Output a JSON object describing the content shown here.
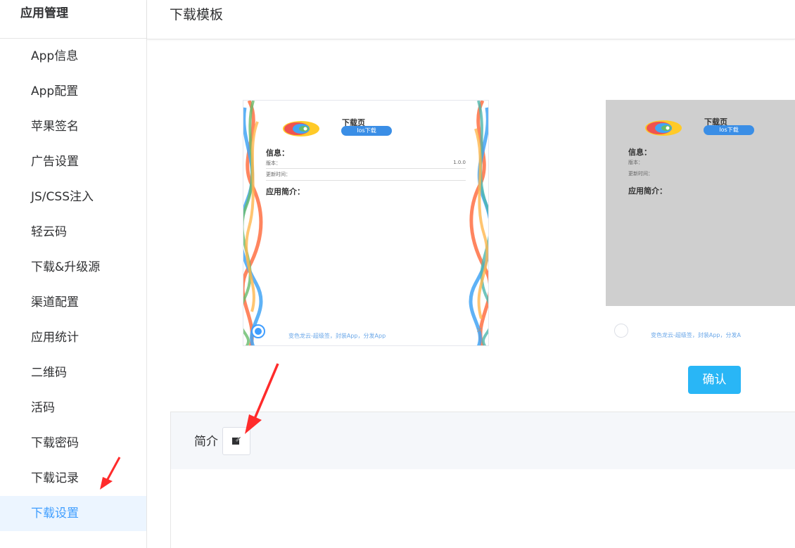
{
  "sidebar": {
    "title": "应用管理",
    "items": [
      {
        "label": "App信息"
      },
      {
        "label": "App配置"
      },
      {
        "label": "苹果签名"
      },
      {
        "label": "广告设置"
      },
      {
        "label": "JS/CSS注入"
      },
      {
        "label": "轻云码"
      },
      {
        "label": "下载&升级源"
      },
      {
        "label": "渠道配置"
      },
      {
        "label": "应用统计"
      },
      {
        "label": "二维码"
      },
      {
        "label": "活码"
      },
      {
        "label": "下载密码"
      },
      {
        "label": "下载记录"
      },
      {
        "label": "下载设置"
      }
    ],
    "active_index": 13
  },
  "header": {
    "title": "下载模板"
  },
  "templates": [
    {
      "page_title": "下载页",
      "ios_button": "Ios下载",
      "info_title": "信息：",
      "version_label": "版本：",
      "version_value": "1.0.0",
      "update_label": "更新时间：",
      "intro_title": "应用简介：",
      "footer": "变色龙云-超级签，封装App，分发App",
      "selected": true
    },
    {
      "page_title": "下载页",
      "ios_button": "Ios下载",
      "info_title": "信息：",
      "version_label": "版本：",
      "update_label": "更新时间：",
      "intro_title": "应用简介：",
      "footer": "变色龙云-超级签，封装App，分发A",
      "selected": false
    }
  ],
  "confirm_button": "确认",
  "intro_section": {
    "label": "简介"
  },
  "icons": {
    "edit": "edit-icon",
    "annotation": "red-arrow"
  },
  "colors": {
    "accent": "#409eff",
    "confirm": "#29b6f6",
    "arrow": "#ff2b2b",
    "template2_bg": "#cfcfcf"
  }
}
